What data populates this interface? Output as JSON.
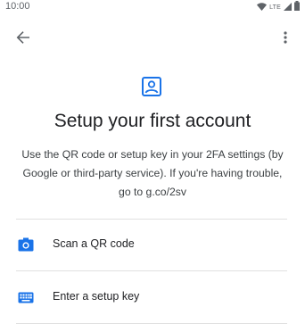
{
  "status_bar": {
    "time": "10:00",
    "network_label": "LTE",
    "icons": [
      "wifi-icon",
      "lte-signal-icon",
      "battery-icon"
    ]
  },
  "app_bar": {
    "back_icon": "arrow-back-icon",
    "menu_icon": "more-vert-icon"
  },
  "header": {
    "icon": "account-box-icon",
    "title": "Setup your first account",
    "description": "Use the QR code or setup key in your 2FA settings (by Google or third-party service). If you're having trouble, go to g.co/2sv"
  },
  "options": [
    {
      "icon": "camera-icon",
      "label": "Scan a QR code"
    },
    {
      "icon": "keyboard-icon",
      "label": "Enter a setup key"
    }
  ],
  "colors": {
    "accent": "#1a73e8",
    "text_primary": "#202124",
    "text_secondary": "#3c4043",
    "divider": "#e0e0e0"
  }
}
